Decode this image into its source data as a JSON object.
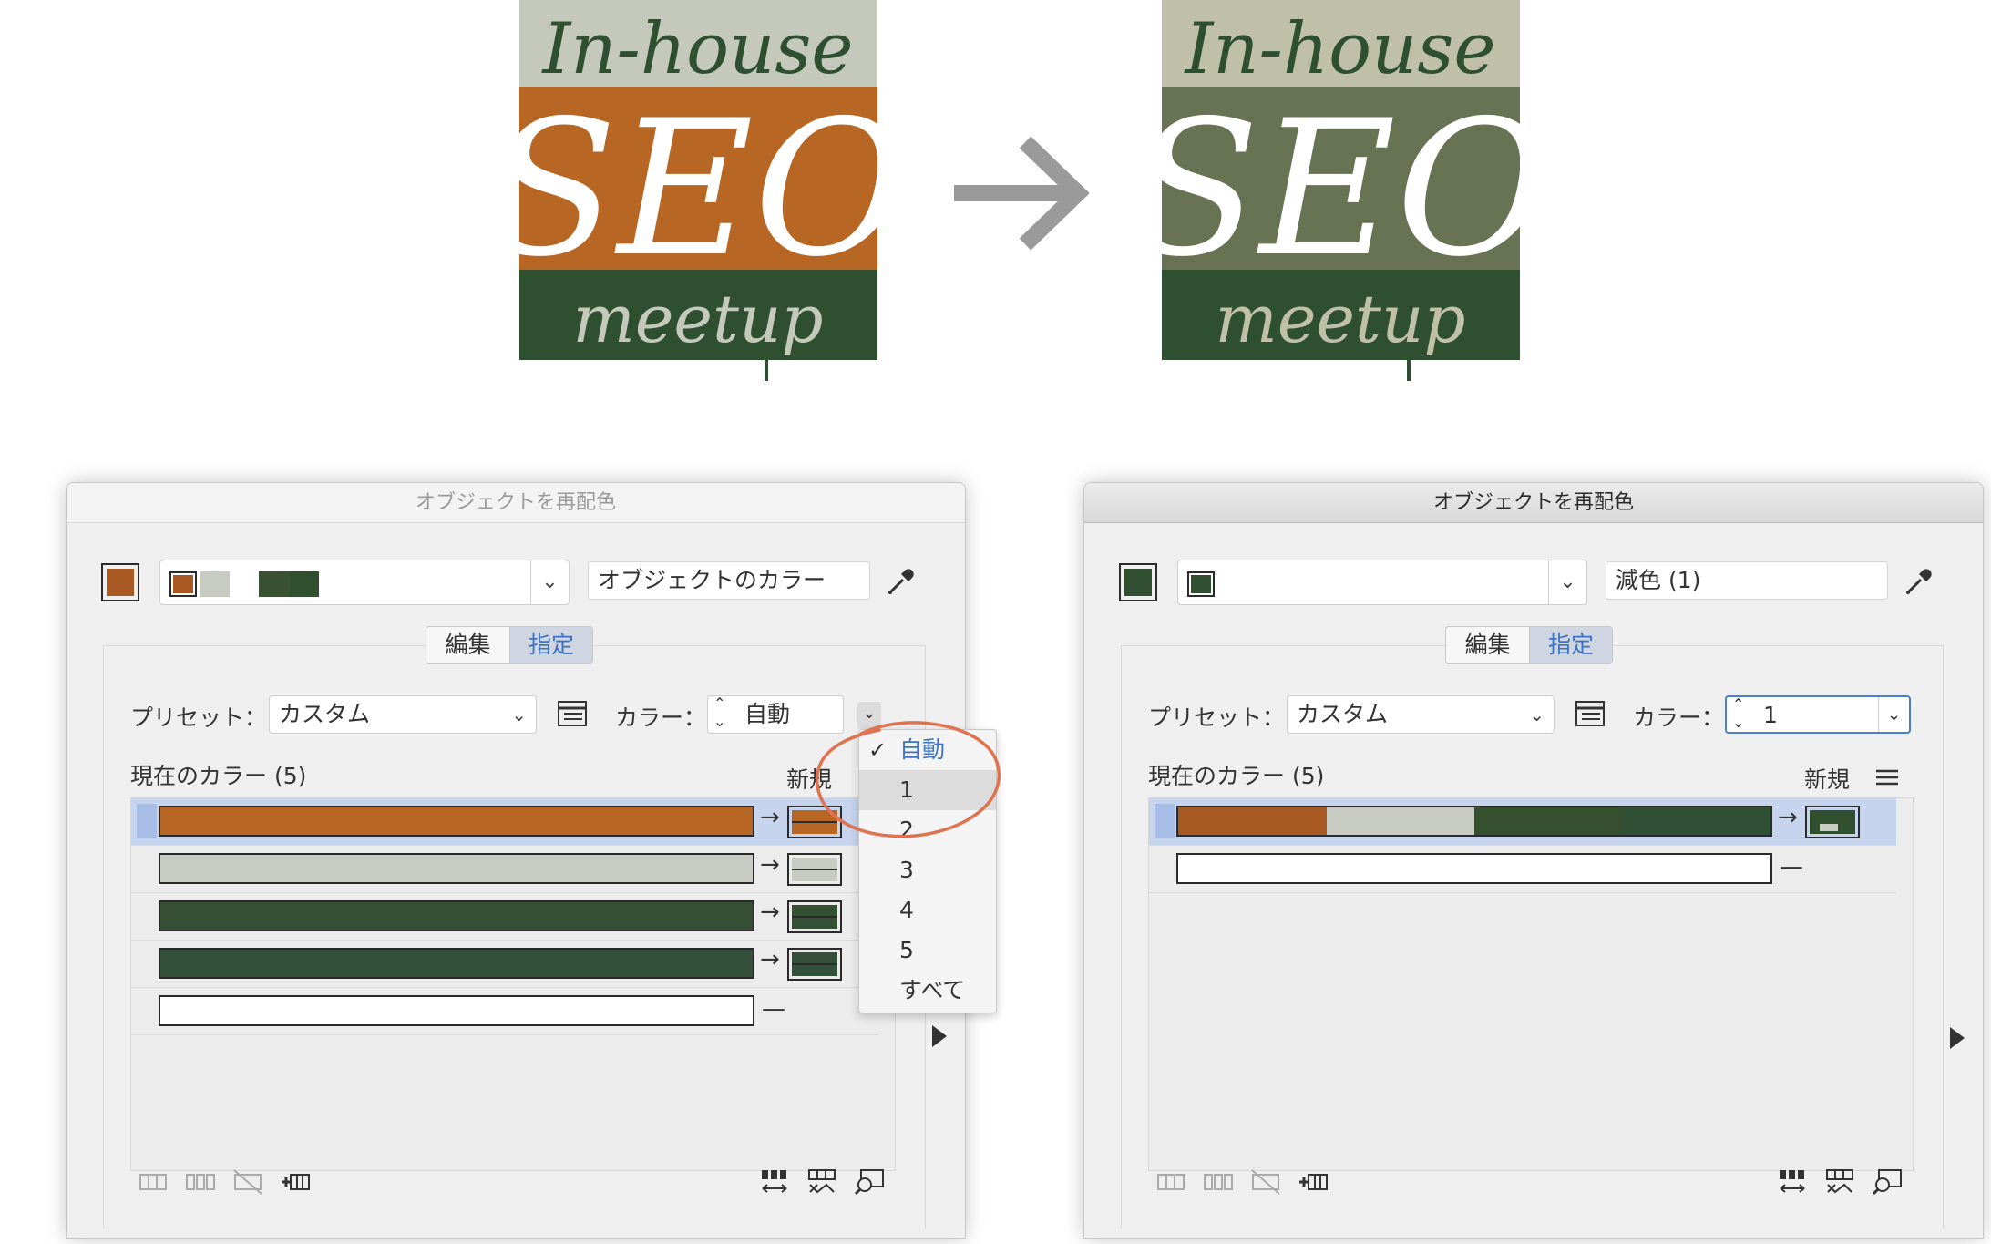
{
  "logos": {
    "before": {
      "line1": "In-house",
      "line2": "SEO",
      "line3": "meetup",
      "colors": {
        "top": "#c4c9bc",
        "middle": "#b86624",
        "bottom": "#2f5030"
      }
    },
    "after": {
      "line1": "In-house",
      "line2": "SEO",
      "line3": "meetup",
      "colors": {
        "top": "#c0c0a9",
        "middle": "#677352",
        "bottom": "#2f5030"
      }
    },
    "arrow_color": "#9a9a9a"
  },
  "left_panel": {
    "title": "オブジェクトを再配色",
    "main_swatch_color": "#a85a22",
    "harmony_strip": [
      "#a85a22",
      "#c8cbc1",
      "#3b5232",
      "#2f4f2f",
      "#ffffff"
    ],
    "source_field": "オブジェクトのカラー",
    "tabs": [
      "編集",
      "指定"
    ],
    "selected_tab": "指定",
    "preset_label": "プリセット：",
    "preset_value": "カスタム",
    "color_label": "カラー：",
    "color_value": "自動",
    "current_colors_label": "現在のカラー (5)",
    "new_label": "新規",
    "rows": [
      {
        "current": [
          "#b86624"
        ],
        "new": "#b86624",
        "arrow": "→"
      },
      {
        "current": [
          "#c8cbc1"
        ],
        "new": "#c8cbc1",
        "arrow": "→"
      },
      {
        "current": [
          "#354f34"
        ],
        "new": "#354f34",
        "arrow": "→"
      },
      {
        "current": [
          "#33503a"
        ],
        "new": "#33503a",
        "arrow": "→"
      },
      {
        "current": [
          "#ffffff"
        ],
        "new": null,
        "arrow": "—"
      }
    ],
    "dropdown": {
      "options": [
        "自動",
        "1",
        "2",
        "3",
        "4",
        "5",
        "すべて"
      ],
      "checked": "自動",
      "hovered": "1",
      "annotation_color": "#e0734f"
    }
  },
  "right_panel": {
    "title": "オブジェクトを再配色",
    "main_swatch_color": "#304f30",
    "harmony_strip": [
      "#304f30"
    ],
    "source_field": "減色 (1)",
    "tabs": [
      "編集",
      "指定"
    ],
    "selected_tab": "指定",
    "preset_label": "プリセット：",
    "preset_value": "カスタム",
    "color_label": "カラー：",
    "color_value": "1",
    "current_colors_label": "現在のカラー (5)",
    "new_label": "新規",
    "rows": [
      {
        "current": [
          "#a85a22",
          "#c8cbc1",
          "#34502f",
          "#2f5034"
        ],
        "new": "#2f4f2f",
        "arrow": "→"
      },
      {
        "current": [
          "#ffffff"
        ],
        "new": null,
        "arrow": "—"
      }
    ]
  }
}
